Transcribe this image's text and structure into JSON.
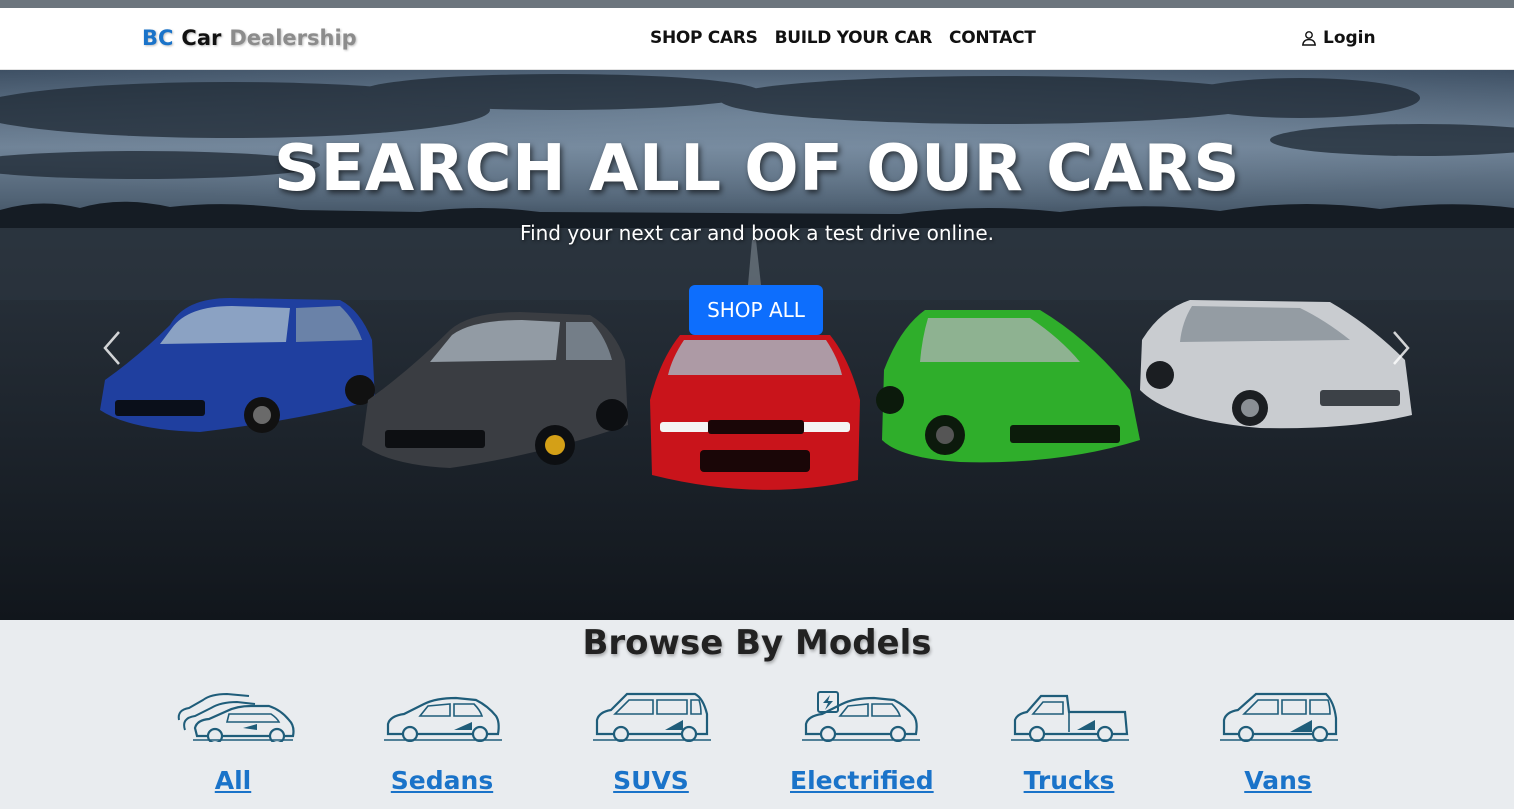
{
  "brand": {
    "part1": "BC",
    "part2": "Car",
    "part3": "Dealership"
  },
  "nav": {
    "links": [
      "SHOP CARS",
      "BUILD YOUR CAR",
      "CONTACT"
    ],
    "login": "Login"
  },
  "hero": {
    "title": "SEARCH ALL OF OUR CARS",
    "subtitle": "Find your next car and book a test drive online.",
    "cta": "SHOP ALL",
    "car_colors": [
      "#1f3f9f",
      "#3a3d42",
      "#c9141b",
      "#2fae2b",
      "#c9ccd0"
    ]
  },
  "browse": {
    "title": "Browse By Models",
    "models": [
      "All",
      "Sedans",
      "SUVS",
      "Electrified",
      "Trucks",
      "Vans"
    ]
  },
  "colors": {
    "accent": "#0d6efd",
    "link": "#1a73c9",
    "icon": "#1f5d7a"
  },
  "icons": [
    "user-icon",
    "chevron-left-icon",
    "chevron-right-icon",
    "car-icon"
  ]
}
